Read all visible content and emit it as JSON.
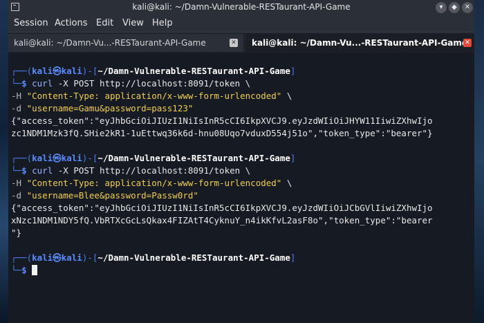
{
  "window": {
    "title": "kali@kali: ~/Damn-Vulnerable-RESTaurant-API-Game",
    "controls": {
      "minimize": "▾",
      "maximize": "◆",
      "close": "✕"
    }
  },
  "menubar": {
    "items": [
      "Session",
      "Actions",
      "Edit",
      "View",
      "Help"
    ]
  },
  "tabs": [
    {
      "label": "kali@kali: ~/Damn-Vu...-RESTaurant-API-Game",
      "active": false
    },
    {
      "label": "kali@kali: ~/Damn-Vu...-RESTaurant-API-Game",
      "active": true
    }
  ],
  "terminal": {
    "prompt_user": "kali",
    "prompt_at": "㉿",
    "prompt_host": "kali",
    "prompt_path": "~/Damn-Vulnerable-RESTaurant-API-Game",
    "prompt_symbol": "$",
    "blocks": [
      {
        "curl": "curl",
        "cmd_rest": " -X POST http://localhost:8091/token \\",
        "header_flag": "-H ",
        "header_value": "\"Content-Type: application/x-www-form-urlencoded\"",
        "header_tail": " \\",
        "data_flag": "-d ",
        "data_value": "\"username=Gamu&password=pass123\"",
        "out1": "{\"access_token\":\"eyJhbGciOiJIUzI1NiIsInR5cCI6IkpXVCJ9.eyJzdWIiOiJHYW11IiwiZXhwIjo",
        "out2": "zc1NDM1Mzk3fQ.SHie2kR1-1uEttwq36k6d-hnu08Uqo7vduxD554j51o\",\"token_type\":\"bearer\"}",
        "out3": ""
      },
      {
        "curl": "curl",
        "cmd_rest": " -X POST http://localhost:8091/token \\",
        "header_flag": "-H ",
        "header_value": "\"Content-Type: application/x-www-form-urlencoded\"",
        "header_tail": " \\",
        "data_flag": "-d ",
        "data_value": "\"username=Blee&password=Passw0rd\"",
        "out1": "{\"access_token\":\"eyJhbGciOiJIUzI1NiIsInR5cCI6IkpXVCJ9.eyJzdWIiOiJCbGVlIiwiZXhwIjo",
        "out2": "xNzc1NDM1NDY5fQ.VbRTXcGcLsQkax4FIZAtT4CyknuY_n4ikKfvL2asF8o\",\"token_type\":\"bearer",
        "out3": "\"}"
      }
    ]
  }
}
